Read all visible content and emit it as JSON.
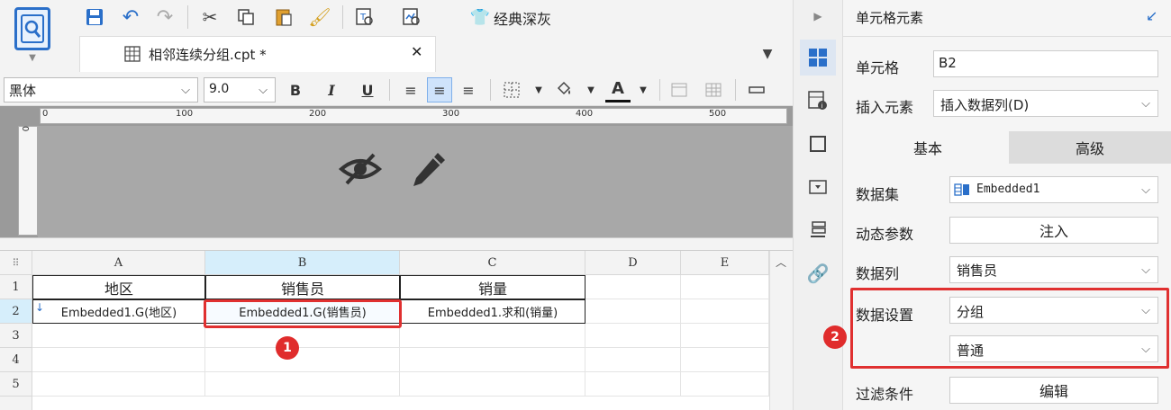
{
  "toolbar": {
    "theme_label": "经典深灰"
  },
  "tab": {
    "title": "相邻连续分组.cpt *",
    "close": "✕"
  },
  "format": {
    "font_name": "黑体",
    "font_size": "9.0",
    "bold": "B",
    "italic": "I",
    "underline": "U",
    "font_color": "A"
  },
  "ruler": {
    "ticks": [
      "0",
      "100",
      "200",
      "300",
      "400",
      "500"
    ],
    "vertical": "0"
  },
  "grid": {
    "columns": [
      "A",
      "B",
      "C",
      "D",
      "E"
    ],
    "rows": [
      "1",
      "2",
      "3",
      "4",
      "5"
    ],
    "header_row": [
      "地区",
      "销售员",
      "销量"
    ],
    "data_row": [
      "Embedded1.G(地区)",
      "Embedded1.G(销售员)",
      "Embedded1.求和(销量)"
    ]
  },
  "badges": {
    "one": "1",
    "two": "2"
  },
  "panel": {
    "title": "单元格元素",
    "cell_label": "单元格",
    "cell_value": "B2",
    "insert_label": "插入元素",
    "insert_value": "插入数据列(D)",
    "tab_basic": "基本",
    "tab_advanced": "高级",
    "dataset_label": "数据集",
    "dataset_value": "Embedded1",
    "dynamic_label": "动态参数",
    "dynamic_button": "注入",
    "column_label": "数据列",
    "column_value": "销售员",
    "setting_label": "数据设置",
    "setting_value": "分组",
    "setting_sub_value": "普通",
    "filter_label": "过滤条件",
    "filter_button": "编辑"
  },
  "colors": {
    "accent": "#2a6fc9",
    "highlight": "#e03030",
    "selected_header": "#d6eefb"
  }
}
